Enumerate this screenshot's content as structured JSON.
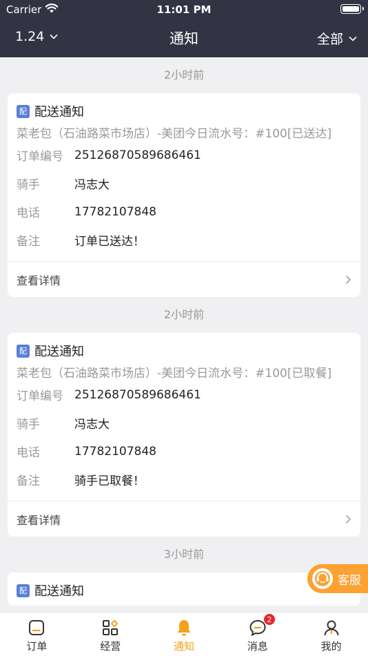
{
  "status_bar": {
    "carrier": "Carrier",
    "time": "11:01 PM"
  },
  "nav": {
    "left": "1.24",
    "title": "通知",
    "right": "全部"
  },
  "notifications": [
    {
      "time": "2小时前",
      "badge": "配",
      "title": "配送通知",
      "subtitle": "菜老包（石油路菜市场店）-美团今日流水号：#100[已送达]",
      "rows": [
        {
          "label": "订单编号",
          "value": "25126870589686461"
        },
        {
          "label": "骑手",
          "value": "冯志大"
        },
        {
          "label": "电话",
          "value": "17782107848"
        },
        {
          "label": "备注",
          "value": "订单已送达！"
        }
      ],
      "footer": "查看详情"
    },
    {
      "time": "2小时前",
      "badge": "配",
      "title": "配送通知",
      "subtitle": "菜老包（石油路菜市场店）-美团今日流水号：#100[已取餐]",
      "rows": [
        {
          "label": "订单编号",
          "value": "25126870589686461"
        },
        {
          "label": "骑手",
          "value": "冯志大"
        },
        {
          "label": "电话",
          "value": "17782107848"
        },
        {
          "label": "备注",
          "value": "骑手已取餐！"
        }
      ],
      "footer": "查看详情"
    },
    {
      "time": "3小时前",
      "badge": "配",
      "title": "配送通知"
    }
  ],
  "customer_service": {
    "label": "客服"
  },
  "tabs": [
    {
      "label": "订单",
      "icon": "order-icon"
    },
    {
      "label": "经营",
      "icon": "grid-icon"
    },
    {
      "label": "通知",
      "icon": "bell-icon",
      "active": true
    },
    {
      "label": "消息",
      "icon": "message-icon",
      "badge": "2"
    },
    {
      "label": "我的",
      "icon": "user-icon"
    }
  ],
  "colors": {
    "header": "#323444",
    "accent": "#f4a21a",
    "badge": "#5b7fd9",
    "notify": "#e8262b"
  }
}
